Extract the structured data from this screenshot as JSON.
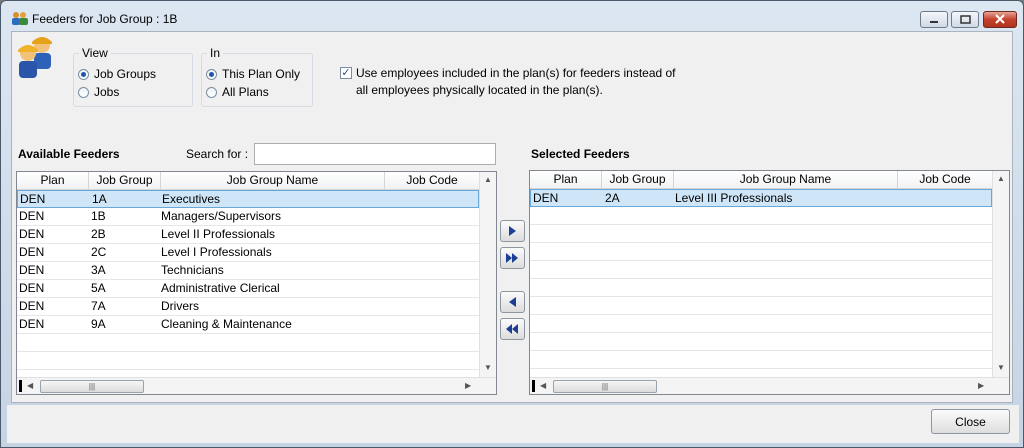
{
  "window": {
    "title": "Feeders for Job Group : 1B"
  },
  "view_group": {
    "label": "View",
    "options": [
      "Job Groups",
      "Jobs"
    ],
    "selected": 0
  },
  "in_group": {
    "label": "In",
    "options": [
      "This Plan Only",
      "All Plans"
    ],
    "selected": 0
  },
  "use_employees": {
    "checked": true,
    "line1": "Use employees included in the plan(s) for feeders instead of",
    "line2": "all employees physically located in the plan(s)."
  },
  "available": {
    "title": "Available Feeders",
    "search_label": "Search for :",
    "search_value": "",
    "columns": [
      "Plan",
      "Job Group",
      "Job Group Name",
      "Job Code"
    ],
    "rows": [
      {
        "plan": "DEN",
        "job_group": "1A",
        "name": "Executives",
        "code": "",
        "selected": true
      },
      {
        "plan": "DEN",
        "job_group": "1B",
        "name": "Managers/Supervisors",
        "code": "",
        "selected": false
      },
      {
        "plan": "DEN",
        "job_group": "2B",
        "name": "Level II Professionals",
        "code": "",
        "selected": false
      },
      {
        "plan": "DEN",
        "job_group": "2C",
        "name": "Level I Professionals",
        "code": "",
        "selected": false
      },
      {
        "plan": "DEN",
        "job_group": "3A",
        "name": "Technicians",
        "code": "",
        "selected": false
      },
      {
        "plan": "DEN",
        "job_group": "5A",
        "name": "Administrative Clerical",
        "code": "",
        "selected": false
      },
      {
        "plan": "DEN",
        "job_group": "7A",
        "name": "Drivers",
        "code": "",
        "selected": false
      },
      {
        "plan": "DEN",
        "job_group": "9A",
        "name": "Cleaning & Maintenance",
        "code": "",
        "selected": false
      }
    ]
  },
  "selected": {
    "title": "Selected Feeders",
    "columns": [
      "Plan",
      "Job Group",
      "Job Group Name",
      "Job Code"
    ],
    "rows": [
      {
        "plan": "DEN",
        "job_group": "2A",
        "name": "Level III Professionals",
        "code": "",
        "selected": true
      }
    ]
  },
  "move_buttons": [
    "move-right-icon",
    "move-all-right-icon",
    "move-left-icon",
    "move-all-left-icon"
  ],
  "footer": {
    "close_label": "Close"
  },
  "colors": {
    "selection": "#cfe6f8",
    "selection_border": "#6aa6d6",
    "title_gradient_top": "#dde7f2"
  }
}
